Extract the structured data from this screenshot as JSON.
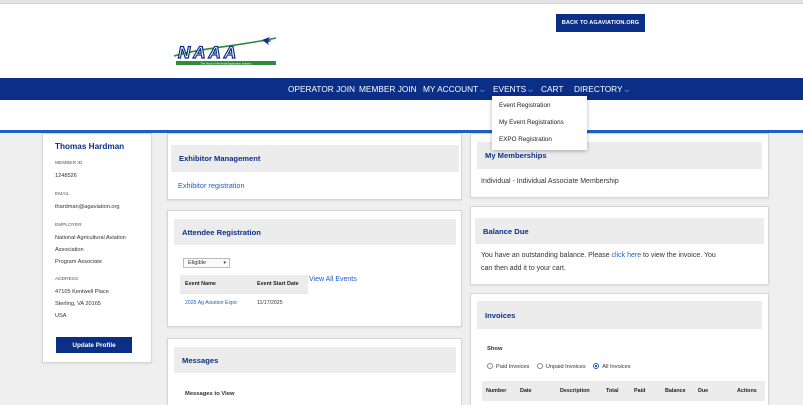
{
  "header": {
    "back_button": "BACK TO AGAVIATION.ORG",
    "logo_text": "NAAA",
    "logo_tagline": "The Voice of the Aerial Application Industry"
  },
  "nav": {
    "items": [
      "OPERATOR JOIN",
      "MEMBER JOIN",
      "MY ACCOUNT",
      "EVENTS",
      "CART",
      "DIRECTORY"
    ]
  },
  "events_menu": [
    "Event Registration",
    "My Event Registrations",
    "EXPO Registration"
  ],
  "profile": {
    "name": "Thomas Hardman",
    "member_id_label": "MEMBER ID",
    "member_id": "1248526",
    "email_label": "EMAIL",
    "email": "thardman@agaviation.org",
    "employer_label": "EMPLOYER",
    "employer_line1": "National Agricultural Aviation",
    "employer_line2": "Association",
    "employer_line3": "Program Associate",
    "address_label": "ADDRESS",
    "address_line1": "47105 Kentwell Place",
    "address_line2": "Sterling, VA 20165",
    "address_line3": "USA",
    "update_button": "Update Profile"
  },
  "exhibitor": {
    "title": "Exhibitor Management",
    "link": "Exhibitor registration"
  },
  "attendee": {
    "title": "Attendee Registration",
    "filter_value": "Eligible",
    "view_all": "View All Events",
    "columns": [
      "Event Name",
      "Event Start Date"
    ],
    "rows": [
      [
        "2025 Ag Aviation Expo",
        "11/17/2025"
      ]
    ]
  },
  "messages": {
    "title": "Messages",
    "subtitle": "Messages to View"
  },
  "memberships": {
    "title": "My Memberships",
    "text": "Individual - Individual Associate Membership"
  },
  "balance": {
    "title": "Balance Due",
    "text_before": "You have an outstanding balance. Please ",
    "link": "click here",
    "text_after": " to view the invoice. You",
    "line2": "can then add it to your cart."
  },
  "invoices": {
    "title": "Invoices",
    "show_label": "Show",
    "options": [
      "Paid Invoices",
      "Unpaid Invoices",
      "All Invoices"
    ],
    "selected": "All Invoices",
    "columns": [
      "Number",
      "Date",
      "Description",
      "Total",
      "Paid",
      "Balance",
      "Due",
      "Actions"
    ]
  },
  "colors": {
    "navy": "#0b2f86",
    "link_blue": "#1c5fc6",
    "logo_green": "#2f8a3a"
  }
}
